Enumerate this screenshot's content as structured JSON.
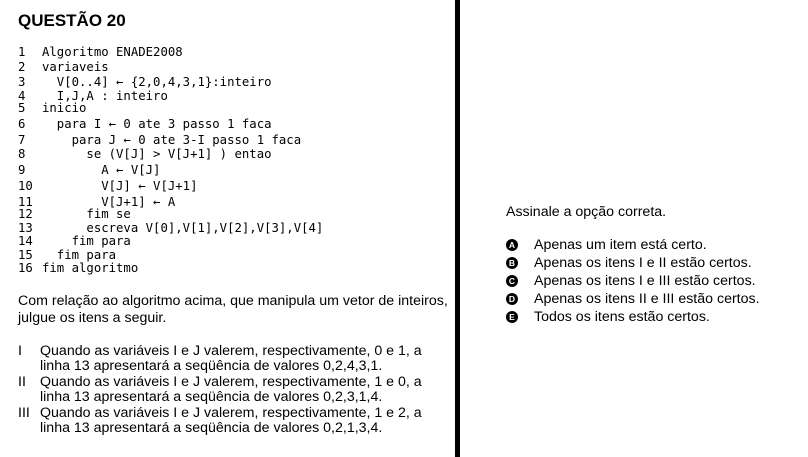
{
  "question_title": "QUESTÃO 20",
  "code_lines": [
    {
      "num": "1",
      "text": "Algoritmo ENADE2008"
    },
    {
      "num": "2",
      "text": "variaveis"
    },
    {
      "num": "3",
      "text": "  V[0..4] ← {2,0,4,3,1}:inteiro"
    },
    {
      "num": "4",
      "text": "  I,J,A : inteiro"
    },
    {
      "num": "5",
      "text": "inicio"
    },
    {
      "num": "6",
      "text": "  para I ← 0 ate 3 passo 1 faca"
    },
    {
      "num": "7",
      "text": "    para J ← 0 ate 3-I passo 1 faca"
    },
    {
      "num": "8",
      "text": "      se (V[J] > V[J+1] ) entao"
    },
    {
      "num": "9",
      "text": "        A ← V[J]"
    },
    {
      "num": "10",
      "text": "        V[J] ← V[J+1]"
    },
    {
      "num": "11",
      "text": "        V[J+1] ← A"
    },
    {
      "num": "12",
      "text": "      fim se"
    },
    {
      "num": "13",
      "text": "      escreva V[0],V[1],V[2],V[3],V[4]"
    },
    {
      "num": "14",
      "text": "    fim para"
    },
    {
      "num": "15",
      "text": "  fim para"
    },
    {
      "num": "16",
      "text": "fim algoritmo"
    }
  ],
  "intro_text": "Com relação ao algoritmo acima, que manipula um vetor de inteiros, julgue os itens a seguir.",
  "items": [
    {
      "marker": "I",
      "text": "Quando as variáveis I e J valerem, respectivamente, 0 e 1, a linha 13 apresentará a seqüência de valores 0,2,4,3,1."
    },
    {
      "marker": "II",
      "text": "Quando as variáveis I e J valerem, respectivamente, 1 e 0, a linha 13 apresentará a seqüência de valores 0,2,3,1,4."
    },
    {
      "marker": "III",
      "text": "Quando as variáveis I e J valerem, respectivamente, 1 e 2, a linha 13 apresentará a seqüência de valores 0,2,1,3,4."
    }
  ],
  "instruction": "Assinale a opção correta.",
  "options": [
    {
      "letter": "A",
      "text": "Apenas um item está certo."
    },
    {
      "letter": "B",
      "text": "Apenas os itens I e II estão certos."
    },
    {
      "letter": "C",
      "text": "Apenas os itens I e III estão certos."
    },
    {
      "letter": "D",
      "text": "Apenas os itens II e III estão certos."
    },
    {
      "letter": "E",
      "text": "Todos os itens estão certos."
    }
  ]
}
